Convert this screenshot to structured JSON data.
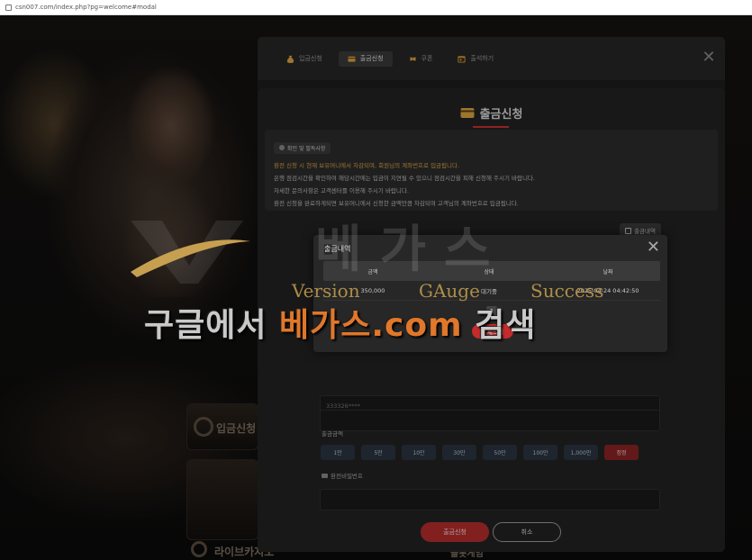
{
  "browser": {
    "url": "csn007.com/index.php?pg=welcome#modal"
  },
  "background": {
    "tile_deposit": "입금신청",
    "tile_live_casino": "라이브카지노",
    "tile_slot": "슬롯게임"
  },
  "tabs": [
    {
      "label": "입금신청",
      "icon": "money-bag-icon"
    },
    {
      "label": "출금신청",
      "icon": "wallet-icon"
    },
    {
      "label": "쿠폰",
      "icon": "coupon-icon"
    },
    {
      "label": "출석하기",
      "icon": "calendar-icon"
    }
  ],
  "panel": {
    "title": "출금신청",
    "notice_badge": "확인 및 필독사항",
    "notice_lines": [
      "환전 신청 시 현재 보유머니에서 차감되며, 회원님의 계좌번호로 입금됩니다.",
      "은행 점검시간을 확인하여 해당시간에는 입금이 지연될 수 있으니 점검시간을 피해 신청해 주시기 바랍니다.",
      "자세한 문의사항은 고객센터를 이용해 주시기 바랍니다.",
      "환전 신청을 완료하게되면 보유머니에서 신청한 금액만큼 차감되며 고객님의 계좌번호로 입금됩니다."
    ],
    "history_button": "출금내역",
    "account_value": "333326****",
    "amount_label": "출금금액",
    "amount_buttons": [
      "1만",
      "5만",
      "10만",
      "30만",
      "50만",
      "100만",
      "1,000만"
    ],
    "reset_button": "정정",
    "password_label": "환전비밀번호",
    "submit_button": "출금신청",
    "cancel_button": "취소"
  },
  "history_modal": {
    "title": "출금내역",
    "columns": [
      "금액",
      "상태",
      "날짜"
    ],
    "rows": [
      {
        "amount": "350,000",
        "status": "대기중",
        "date": "2025-04-24 04:42:50"
      }
    ],
    "page": "1",
    "delete_all_button": "전체삭제"
  },
  "watermark": {
    "brand_kr": "베가스",
    "sub_words": [
      "Version",
      "GAuge",
      "Success"
    ],
    "search_prefix": "구글에서 ",
    "search_accent": "베가스.com",
    "search_suffix": " 검색"
  },
  "colors": {
    "accent_red": "#c62b2b",
    "notice_highlight": "#d8a04a",
    "watermark_orange": "#e0772a",
    "gold": "#c6a050"
  }
}
